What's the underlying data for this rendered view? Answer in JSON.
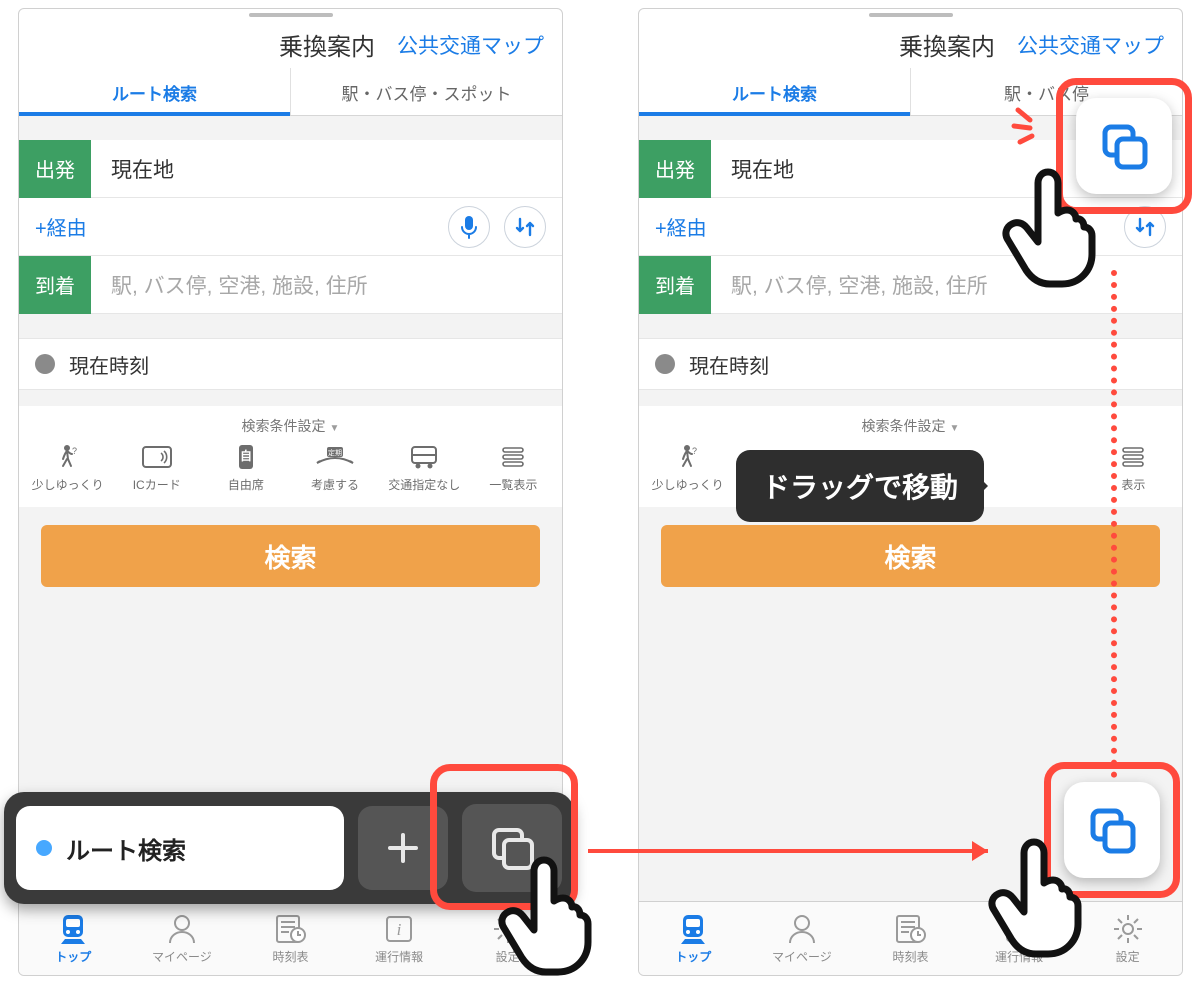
{
  "header": {
    "title": "乗換案内",
    "map_link": "公共交通マップ"
  },
  "tabs": {
    "route": "ルート検索",
    "station": "駅・バス停・スポット",
    "station_clipped": "駅・バス停"
  },
  "form": {
    "depart_badge": "出発",
    "depart_value": "現在地",
    "via_label": "+経由",
    "arrive_badge": "到着",
    "arrive_placeholder": "駅, バス停, 空港, 施設, 住所",
    "time_label": "現在時刻"
  },
  "conditions": {
    "header": "検索条件設定",
    "items": [
      {
        "icon": "walk",
        "label": "少しゆっくり"
      },
      {
        "icon": "ic",
        "label": "ICカード"
      },
      {
        "icon": "seat",
        "label": "自由席"
      },
      {
        "icon": "commuter",
        "label": "考慮する"
      },
      {
        "icon": "bus",
        "label": "交通指定なし"
      },
      {
        "icon": "list",
        "label": "一覧表示"
      }
    ]
  },
  "search_button": "検索",
  "nav": [
    {
      "icon": "train",
      "label": "トップ",
      "active": true
    },
    {
      "icon": "user",
      "label": "マイページ",
      "active": false
    },
    {
      "icon": "timetable",
      "label": "時刻表",
      "active": false
    },
    {
      "icon": "info",
      "label": "運行情報",
      "active": false
    },
    {
      "icon": "gear",
      "label": "設定",
      "active": false
    }
  ],
  "overlay": {
    "chip_label": "ルート検索",
    "tooltip": "ドラッグで移動",
    "list_suffix": "表示"
  }
}
